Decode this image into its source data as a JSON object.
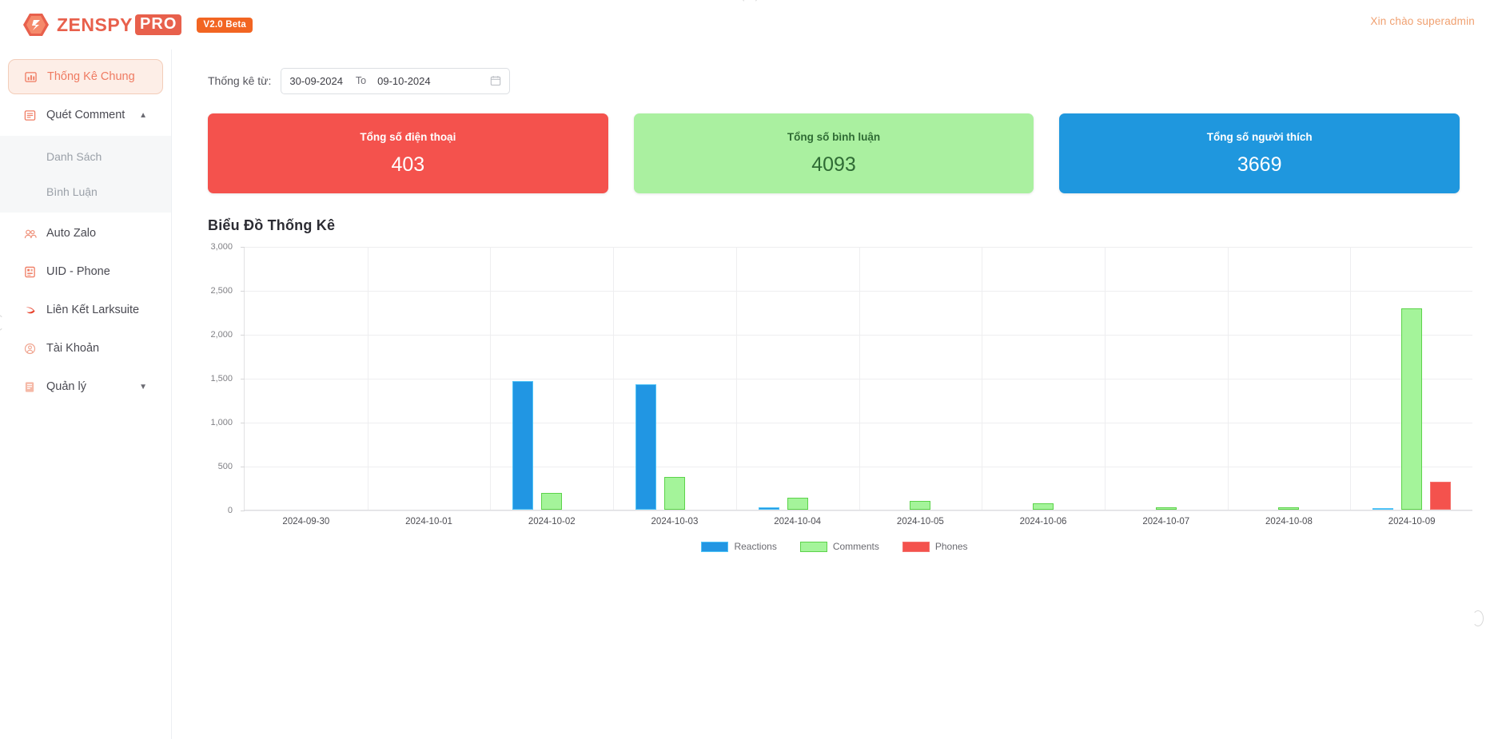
{
  "header": {
    "logo_text_primary": "ZENSPY",
    "logo_text_badge": "PRO",
    "version_badge": "V2.0 Beta",
    "greeting": "Xin chào superadmin"
  },
  "sidebar": {
    "items": [
      {
        "label": "Thống Kê Chung",
        "icon": "chart-bar-icon",
        "active": true
      },
      {
        "label": "Quét Comment",
        "icon": "comment-scan-icon",
        "expanded": true
      },
      {
        "label": "Auto Zalo",
        "icon": "zalo-icon"
      },
      {
        "label": "UID - Phone",
        "icon": "uid-phone-icon"
      },
      {
        "label": "Liên Kết Larksuite",
        "icon": "larksuite-icon"
      },
      {
        "label": "Tài Khoản",
        "icon": "account-icon"
      },
      {
        "label": "Quản lý",
        "icon": "management-icon",
        "collapsed": true
      }
    ],
    "sub_items": [
      {
        "label": "Danh Sách"
      },
      {
        "label": "Bình Luận"
      }
    ]
  },
  "filter": {
    "label": "Thống kê từ:",
    "date_from": "30-09-2024",
    "separator": "To",
    "date_to": "09-10-2024",
    "calendar_icon": "calendar-icon"
  },
  "cards": [
    {
      "title": "Tổng số điện thoại",
      "value": "403",
      "color": "#f4524d"
    },
    {
      "title": "Tổng số bình luận",
      "value": "4093",
      "color": "#aaf0a0"
    },
    {
      "title": "Tổng số người thích",
      "value": "3669",
      "color": "#1f97de"
    }
  ],
  "chart_data": {
    "type": "bar",
    "title": "Biểu Đồ Thống Kê",
    "xlabel": "",
    "ylabel": "",
    "ylim": [
      0,
      3000
    ],
    "yticks": [
      "0",
      "500",
      "1,000",
      "1,500",
      "2,000",
      "2,500",
      "3,000"
    ],
    "ytick_values": [
      0,
      500,
      1000,
      1500,
      2000,
      2500,
      3000
    ],
    "grid": true,
    "legend_position": "bottom",
    "categories": [
      "2024-09-30",
      "2024-10-01",
      "2024-10-02",
      "2024-10-03",
      "2024-10-04",
      "2024-10-05",
      "2024-10-06",
      "2024-10-07",
      "2024-10-08",
      "2024-10-09"
    ],
    "series": [
      {
        "name": "Reactions",
        "color": "#2196e3",
        "values": [
          0,
          0,
          1465,
          1430,
          30,
          0,
          0,
          0,
          0,
          20
        ]
      },
      {
        "name": "Comments",
        "color": "#a4f49a",
        "values": [
          0,
          0,
          195,
          375,
          140,
          100,
          75,
          30,
          30,
          2290
        ]
      },
      {
        "name": "Phones",
        "color": "#f4524d",
        "values": [
          0,
          0,
          0,
          0,
          0,
          0,
          0,
          0,
          0,
          320
        ]
      }
    ]
  }
}
